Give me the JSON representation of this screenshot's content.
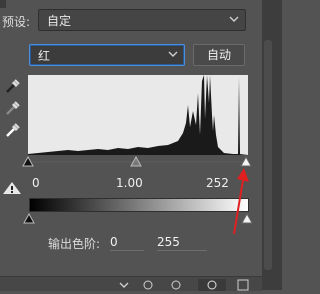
{
  "preset": {
    "label": "预设:",
    "value": "自定"
  },
  "channel": {
    "value": "红"
  },
  "auto_button": {
    "label": "自动"
  },
  "input_levels": {
    "black": "0",
    "gamma": "1.00",
    "white": "252"
  },
  "output_levels": {
    "label": "输出色阶:",
    "black": "0",
    "white": "255"
  },
  "icons": {
    "black_eyedropper": "eyedropper-black",
    "gray_eyedropper": "eyedropper-gray",
    "white_eyedropper": "eyedropper-white",
    "clipping_warning": "clipping-warning-icon",
    "annotation_arrow": "red-arrow"
  },
  "colors": {
    "panel": "#535353",
    "histogram_bg": "#e9e9e9",
    "focus": "#4a8ee0",
    "arrow": "#e02020"
  }
}
